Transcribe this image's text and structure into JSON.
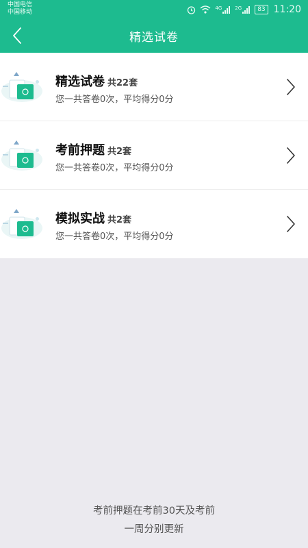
{
  "status_bar": {
    "carrier1": "中国电信",
    "carrier2": "中国移动",
    "net1": "4G",
    "net2": "2G",
    "battery": "83",
    "time": "11:20"
  },
  "header": {
    "title": "精选试卷"
  },
  "items": [
    {
      "title": "精选试卷",
      "count": "共22套",
      "subtitle": "您一共答卷0次，平均得分0分"
    },
    {
      "title": "考前押题",
      "count": "共2套",
      "subtitle": "您一共答卷0次，平均得分0分"
    },
    {
      "title": "模拟实战",
      "count": "共2套",
      "subtitle": "您一共答卷0次，平均得分0分"
    }
  ],
  "footer": {
    "line1": "考前押题在考前30天及考前",
    "line2": "一周分别更新"
  },
  "colors": {
    "accent": "#1dbb8f",
    "background": "#ebeaef"
  }
}
